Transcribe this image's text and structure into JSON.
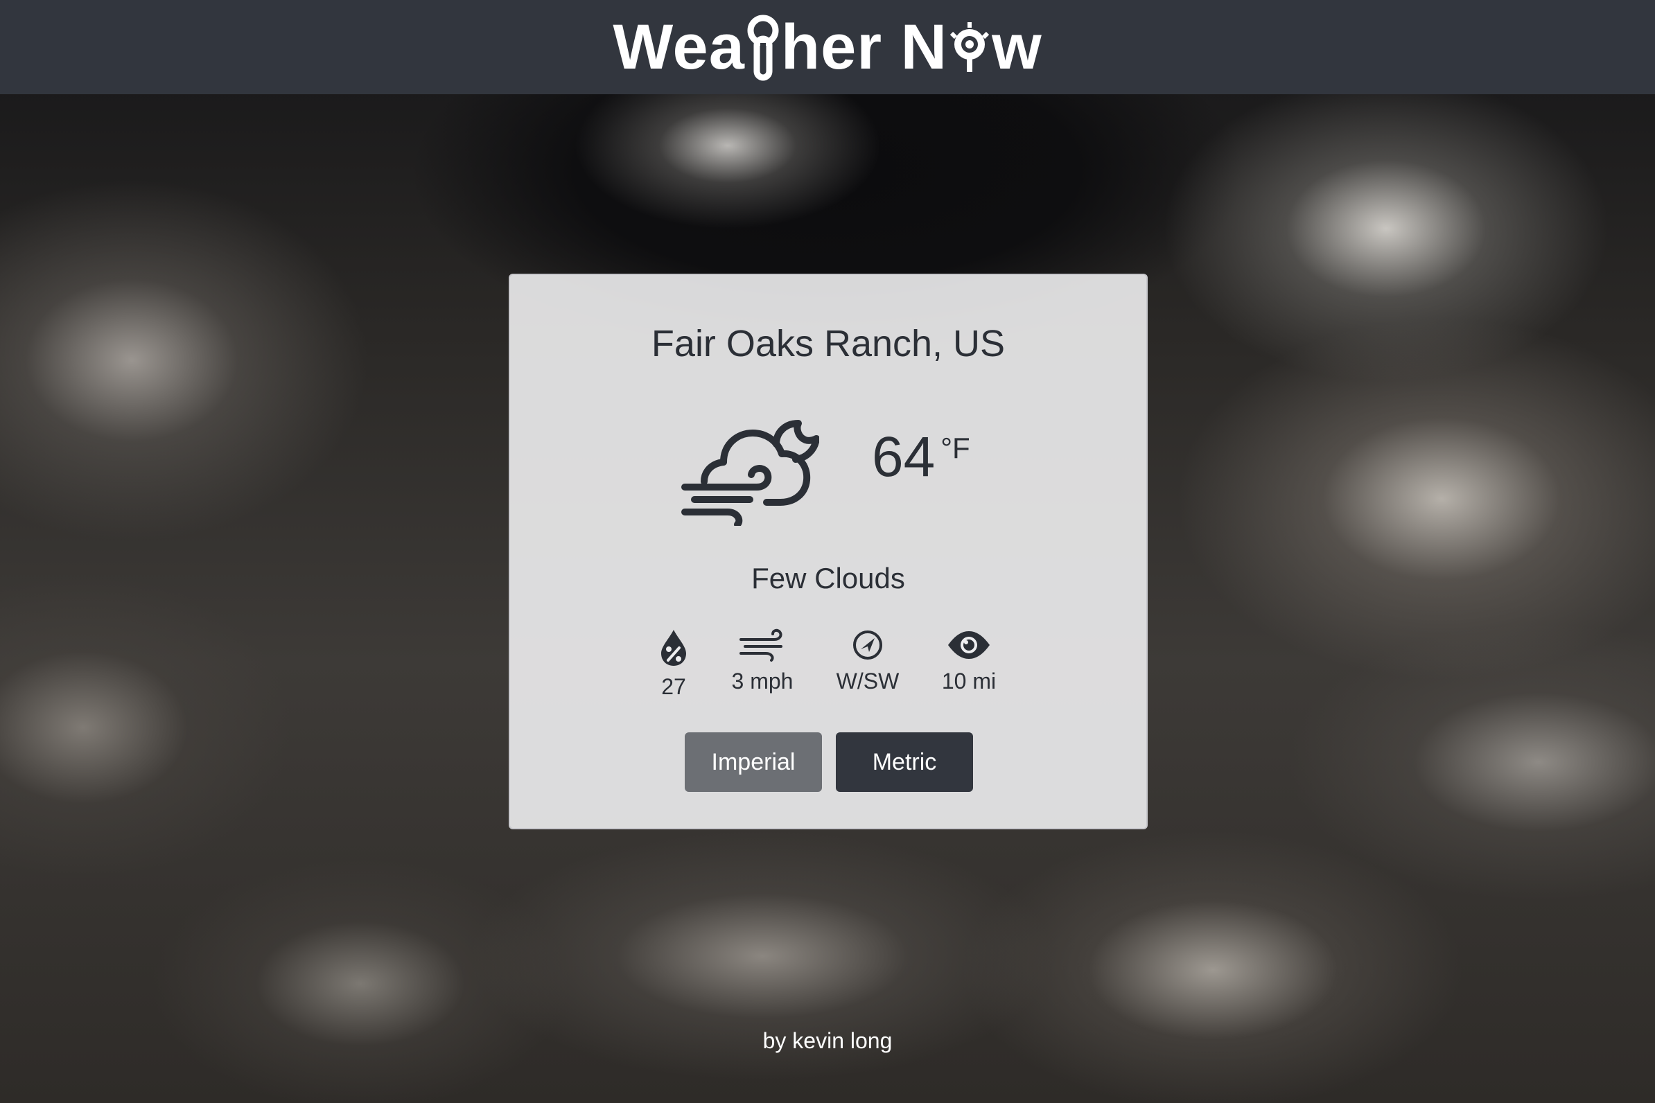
{
  "header": {
    "title_part1": "Wea",
    "title_part2": "her N",
    "title_part3": "w"
  },
  "weather": {
    "location": "Fair Oaks Ranch, US",
    "icon": "cloudy-windy-icon",
    "temperature": "64",
    "unit": "°F",
    "description": "Few Clouds"
  },
  "stats": [
    {
      "icon": "humidity-icon",
      "value": "27"
    },
    {
      "icon": "wind-speed-icon",
      "value": "3 mph"
    },
    {
      "icon": "wind-direction-icon",
      "value": "W/SW"
    },
    {
      "icon": "visibility-icon",
      "value": "10 mi"
    }
  ],
  "units": {
    "imperial_label": "Imperial",
    "metric_label": "Metric"
  },
  "footer": {
    "credit": "by kevin long"
  },
  "colors": {
    "header_bg": "#32363e",
    "text_dark": "#2b2f36",
    "imperial_button": "#6c6f74",
    "metric_button": "#32363e"
  }
}
